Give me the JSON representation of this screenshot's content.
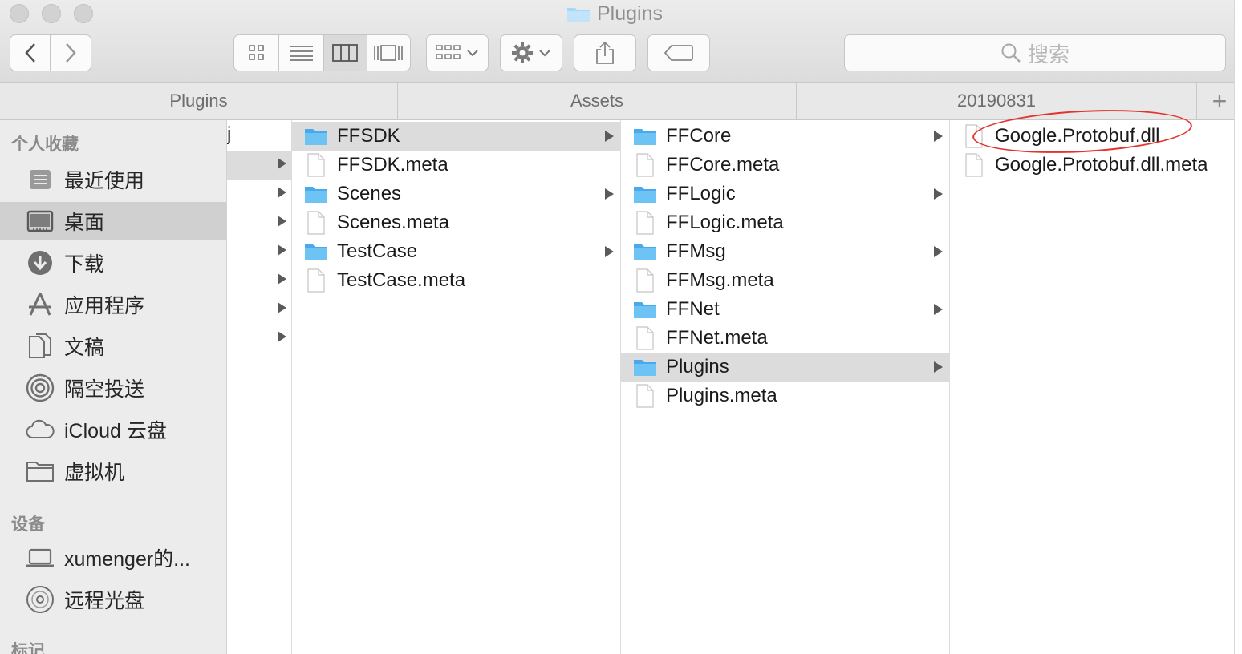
{
  "window": {
    "title": "Plugins"
  },
  "toolbar": {
    "back_icon": "chevron-left-icon",
    "forward_icon": "chevron-right-icon",
    "view_modes": [
      "icon-view-icon",
      "list-view-icon",
      "column-view-icon",
      "gallery-view-icon"
    ],
    "active_view": "column-view-icon",
    "search_placeholder": "搜索"
  },
  "pathbar": {
    "crumbs": [
      "Plugins",
      "Assets",
      "20190831"
    ],
    "add_label": "+"
  },
  "sidebar": {
    "favorites_header": "个人收藏",
    "favorites": [
      {
        "label": "最近使用",
        "icon": "recents-icon"
      },
      {
        "label": "桌面",
        "icon": "desktop-icon",
        "selected": true
      },
      {
        "label": "下载",
        "icon": "download-icon"
      },
      {
        "label": "应用程序",
        "icon": "applications-icon"
      },
      {
        "label": "文稿",
        "icon": "documents-icon"
      },
      {
        "label": "隔空投送",
        "icon": "airdrop-icon"
      },
      {
        "label": "iCloud 云盘",
        "icon": "icloud-icon"
      },
      {
        "label": "虚拟机",
        "icon": "folder-icon"
      }
    ],
    "devices_header": "设备",
    "devices": [
      {
        "label": "xumenger的...",
        "icon": "laptop-icon"
      },
      {
        "label": "远程光盘",
        "icon": "disc-icon"
      }
    ],
    "tags_header": "标记"
  },
  "columns": {
    "col0_partial_text": "j",
    "col1": [
      {
        "name": "FFSDK",
        "type": "folder",
        "selected": true
      },
      {
        "name": "FFSDK.meta",
        "type": "file"
      },
      {
        "name": "Scenes",
        "type": "folder"
      },
      {
        "name": "Scenes.meta",
        "type": "file"
      },
      {
        "name": "TestCase",
        "type": "folder"
      },
      {
        "name": "TestCase.meta",
        "type": "file"
      }
    ],
    "col2": [
      {
        "name": "FFCore",
        "type": "folder"
      },
      {
        "name": "FFCore.meta",
        "type": "file"
      },
      {
        "name": "FFLogic",
        "type": "folder"
      },
      {
        "name": "FFLogic.meta",
        "type": "file"
      },
      {
        "name": "FFMsg",
        "type": "folder"
      },
      {
        "name": "FFMsg.meta",
        "type": "file"
      },
      {
        "name": "FFNet",
        "type": "folder"
      },
      {
        "name": "FFNet.meta",
        "type": "file"
      },
      {
        "name": "Plugins",
        "type": "folder",
        "selected": true
      },
      {
        "name": "Plugins.meta",
        "type": "file"
      }
    ],
    "col3": [
      {
        "name": "Google.Protobuf.dll",
        "type": "file",
        "annotated": true
      },
      {
        "name": "Google.Protobuf.dll.meta",
        "type": "file"
      }
    ]
  },
  "colors": {
    "annotation": "#e5322d",
    "folder": "#6ec3f5",
    "selection": "#dcdcdc"
  }
}
